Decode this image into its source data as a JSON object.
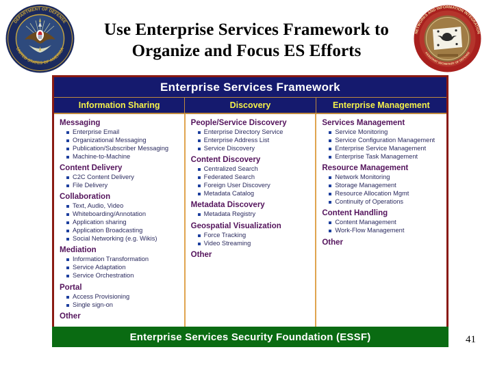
{
  "slide": {
    "title_line1": "Use Enterprise Services Framework to",
    "title_line2": "Organize and Focus ES Efforts",
    "number": "41"
  },
  "seals": {
    "left": {
      "name": "department-of-defense-seal",
      "ring_text_top": "DEPARTMENT OF DEFENSE",
      "ring_text_bottom": "UNITED STATES OF AMERICA"
    },
    "right": {
      "name": "networks-and-information-integration-seal",
      "ring_text_top": "NETWORKS AND INFORMATION INTEGRATION",
      "ring_text_bottom": "ASSISTANT SECRETARY OF DEFENSE"
    }
  },
  "framework": {
    "title": "Enterprise Services Framework",
    "columns": [
      {
        "header": "Information Sharing",
        "groups": [
          {
            "title": "Messaging",
            "items": [
              "Enterprise Email",
              "Organizational Messaging",
              "Publication/Subscriber Messaging",
              "Machine-to-Machine"
            ]
          },
          {
            "title": "Content Delivery",
            "items": [
              "C2C Content Delivery",
              "File Delivery"
            ]
          },
          {
            "title": "Collaboration",
            "items": [
              "Text, Audio, Video",
              "Whiteboarding/Annotation",
              "Application sharing",
              "Application Broadcasting",
              "Social Networking (e.g. Wikis)"
            ]
          },
          {
            "title": "Mediation",
            "items": [
              "Information Transformation",
              "Service Adaptation",
              "Service Orchestration"
            ]
          },
          {
            "title": "Portal",
            "items": [
              "Access Provisioning",
              "Single sign-on"
            ]
          },
          {
            "title": "Other",
            "items": []
          }
        ]
      },
      {
        "header": "Discovery",
        "groups": [
          {
            "title": "People/Service Discovery",
            "items": [
              "Enterprise Directory Service",
              "Enterprise Address List",
              "Service Discovery"
            ]
          },
          {
            "title": "Content Discovery",
            "items": [
              "Centralized Search",
              "Federated Search",
              "Foreign User Discovery",
              "Metadata Catalog"
            ]
          },
          {
            "title": "Metadata Discovery",
            "items": [
              "Metadata Registry"
            ]
          },
          {
            "title": "Geospatial Visualization",
            "items": [
              "Force Tracking",
              "Video Streaming"
            ]
          },
          {
            "title": "Other",
            "items": []
          }
        ]
      },
      {
        "header": "Enterprise Management",
        "groups": [
          {
            "title": "Services Management",
            "items": [
              "Service Monitoring",
              "Service Configuration Management",
              "Enterprise Service Management",
              "Enterprise Task Management"
            ]
          },
          {
            "title": "Resource Management",
            "items": [
              "Network Monitoring",
              "Storage Management",
              "Resource Allocation Mgmt",
              "Continuity of Operations"
            ]
          },
          {
            "title": "Content Handling",
            "items": [
              "Content Management",
              "Work-Flow Management"
            ]
          },
          {
            "title": "Other",
            "items": []
          }
        ]
      }
    ]
  },
  "footer": {
    "essf_label": "Enterprise Services Security Foundation (ESSF)"
  },
  "colors": {
    "header_navy": "#151a6e",
    "subhead_yellow": "#f5f14a",
    "group_purple": "#54145c",
    "item_navy": "#2a2a5e",
    "divider_orange": "#e0a44e",
    "border_maroon": "#8a1a12",
    "footer_green": "#0a6b12"
  }
}
